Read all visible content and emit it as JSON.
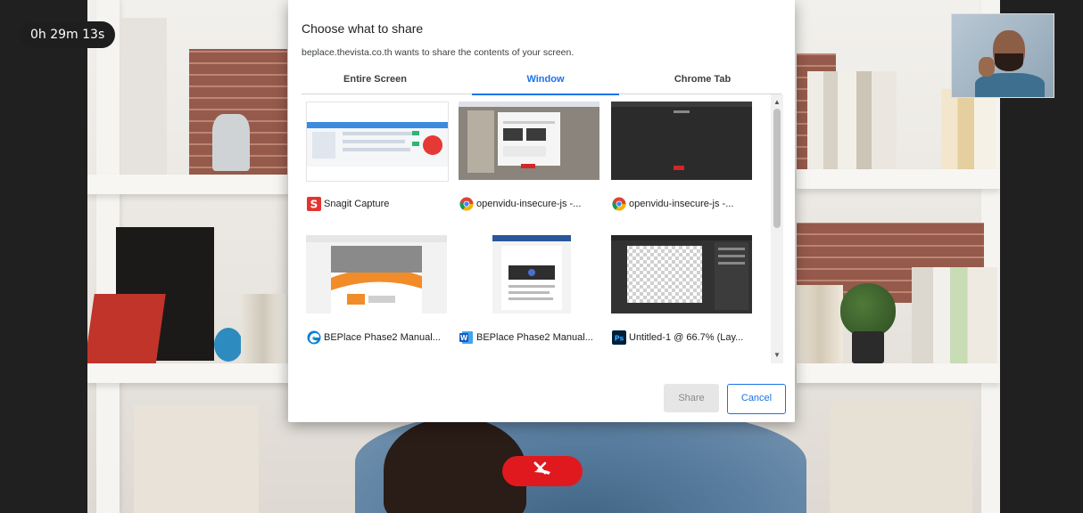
{
  "call": {
    "elapsed": "0h 29m 13s"
  },
  "dialog": {
    "title": "Choose what to share",
    "subtitle": "beplace.thevista.co.th wants to share the contents of your screen.",
    "tabs": [
      {
        "label": "Entire Screen",
        "active": false
      },
      {
        "label": "Window",
        "active": true
      },
      {
        "label": "Chrome Tab",
        "active": false
      }
    ],
    "windows": [
      {
        "label": "Snagit Capture",
        "icon": "snagit-icon"
      },
      {
        "label": "openvidu-insecure-js -...",
        "icon": "chrome-icon"
      },
      {
        "label": "openvidu-insecure-js -...",
        "icon": "chrome-icon"
      },
      {
        "label": "BEPlace Phase2 Manual...",
        "icon": "edge-icon"
      },
      {
        "label": "BEPlace Phase2 Manual...",
        "icon": "word-icon"
      },
      {
        "label": "Untitled-1 @ 66.7% (Lay...",
        "icon": "photoshop-icon"
      }
    ],
    "share_label": "Share",
    "cancel_label": "Cancel"
  },
  "colors": {
    "accent": "#1a73e8",
    "hangup": "#e0191f"
  }
}
